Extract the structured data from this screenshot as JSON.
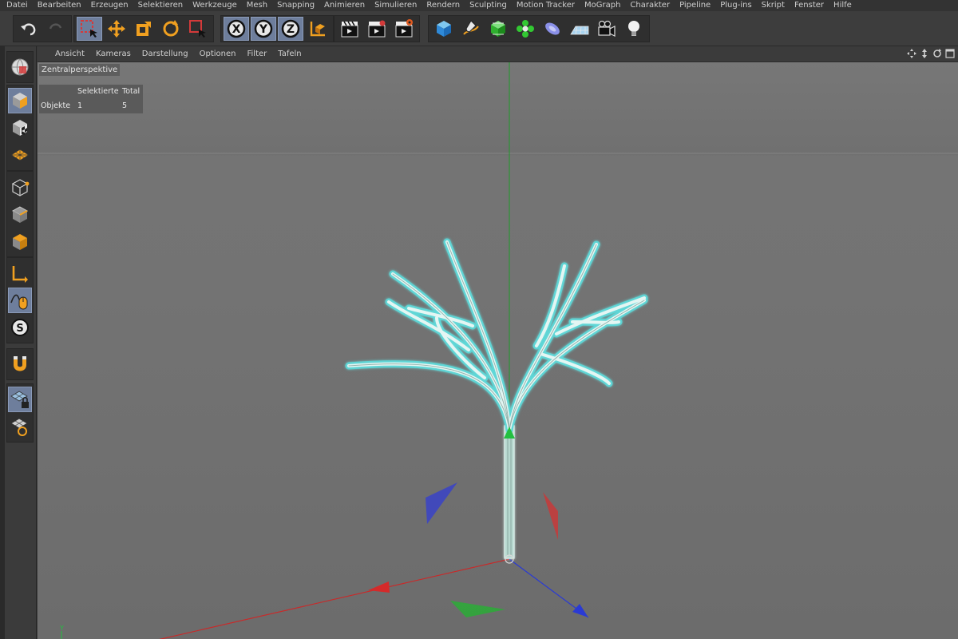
{
  "menubar": {
    "items": [
      "Datei",
      "Bearbeiten",
      "Erzeugen",
      "Selektieren",
      "Werkzeuge",
      "Mesh",
      "Snapping",
      "Animieren",
      "Simulieren",
      "Rendern",
      "Sculpting",
      "Motion Tracker",
      "MoGraph",
      "Charakter",
      "Pipeline",
      "Plug-ins",
      "Skript",
      "Fenster",
      "Hilfe"
    ]
  },
  "toolbar": {
    "axis_labels": {
      "x": "X",
      "y": "Y",
      "z": "Z"
    },
    "active_tool": "selection"
  },
  "viewport_menu": {
    "items": [
      "Ansicht",
      "Kameras",
      "Darstellung",
      "Optionen",
      "Filter",
      "Tafeln"
    ]
  },
  "viewport": {
    "camera_label": "Zentralperspektive",
    "stats": {
      "header_selected": "Selektierte",
      "header_total": "Total",
      "row_label": "Objekte",
      "selected": "1",
      "total": "5"
    },
    "axis_indicator": "Y"
  },
  "colors": {
    "axis_x": "#d42a2a",
    "axis_y": "#22c040",
    "axis_z": "#2a3ad4",
    "selection_highlight": "#5ad8d8",
    "active_button": "#6e7e9c"
  }
}
